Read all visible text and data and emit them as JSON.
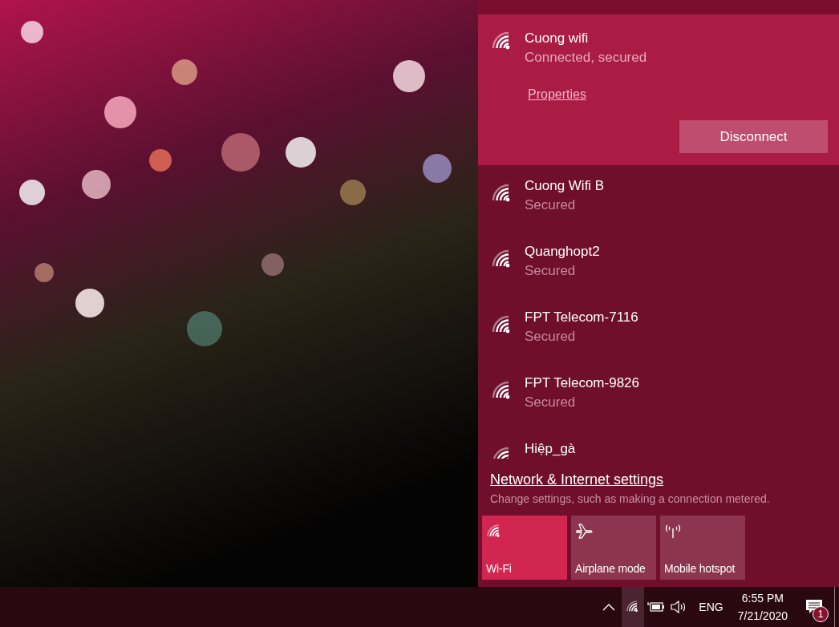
{
  "connected_network": {
    "name": "Cuong wifi",
    "status": "Connected, secured",
    "link": "Properties",
    "button": "Disconnect"
  },
  "networks": [
    {
      "name": "Cuong Wifi B",
      "status": "Secured"
    },
    {
      "name": "Quanghopt2",
      "status": "Secured"
    },
    {
      "name": "FPT Telecom-7116",
      "status": "Secured"
    },
    {
      "name": "FPT Telecom-9826",
      "status": "Secured"
    },
    {
      "name": "Hiệp_gà"
    }
  ],
  "settings": {
    "link": "Network & Internet settings",
    "description": "Change settings, such as making a connection metered."
  },
  "tiles": [
    {
      "kind": "wifi",
      "label": "Wi-Fi",
      "on": true
    },
    {
      "kind": "airplane",
      "label": "Airplane mode",
      "on": false
    },
    {
      "kind": "hotspot",
      "label": "Mobile hotspot",
      "on": false
    }
  ],
  "taskbar": {
    "network_selected": true,
    "language": "ENG",
    "time": "6:55 PM",
    "date": "7/21/2020",
    "notification_count": "1"
  }
}
